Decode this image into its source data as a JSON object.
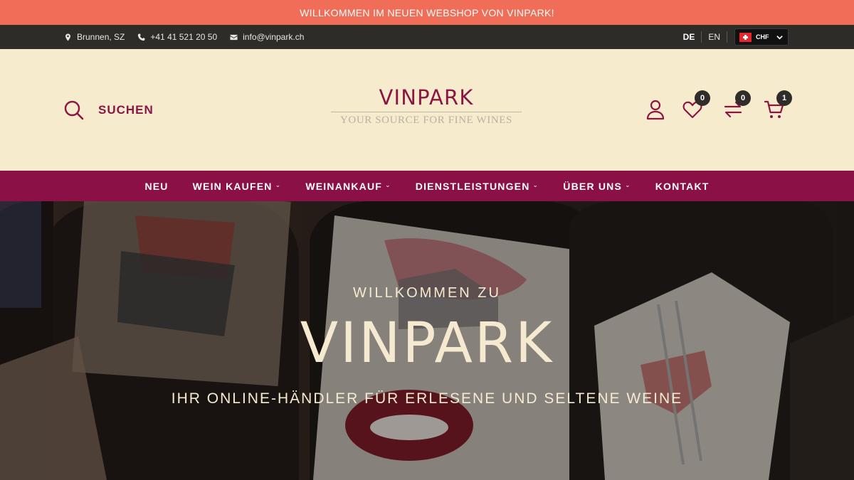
{
  "announcement": "WILLKOMMEN IM NEUEN WEBSHOP VON VINPARK!",
  "topbar": {
    "location": "Brunnen, SZ",
    "phone": "+41 41 521 20 50",
    "email": "info@vinpark.ch",
    "languages": [
      "DE",
      "EN"
    ],
    "active_language": "DE",
    "currency": "CHF"
  },
  "header": {
    "search_label": "SUCHEN",
    "logo_name": "VINPARK",
    "logo_tagline": "YOUR SOURCE FOR FINE WINES",
    "wishlist_count": "0",
    "compare_count": "0",
    "cart_count": "1"
  },
  "nav": {
    "items": [
      {
        "label": "NEU",
        "dropdown": false
      },
      {
        "label": "WEIN KAUFEN",
        "dropdown": true
      },
      {
        "label": "WEINANKAUF",
        "dropdown": true
      },
      {
        "label": "DIENSTLEISTUNGEN",
        "dropdown": true
      },
      {
        "label": "ÜBER UNS",
        "dropdown": true
      },
      {
        "label": "KONTAKT",
        "dropdown": false
      }
    ]
  },
  "hero": {
    "pre_title": "WILLKOMMEN ZU",
    "title": "VINPARK",
    "subtitle": "IHR ONLINE-HÄNDLER FÜR ERLESENE UND SELTENE WEINE"
  },
  "colors": {
    "announcement_bg": "#f06d58",
    "topbar_bg": "#2d2c28",
    "header_bg": "#f7ebcd",
    "brand": "#8b1045",
    "hero_text": "#f5ead0"
  },
  "icons": [
    "map-pin-icon",
    "phone-icon",
    "mail-icon",
    "swiss-flag-icon",
    "chevron-down-icon",
    "search-icon",
    "user-icon",
    "heart-icon",
    "compare-icon",
    "cart-icon"
  ]
}
